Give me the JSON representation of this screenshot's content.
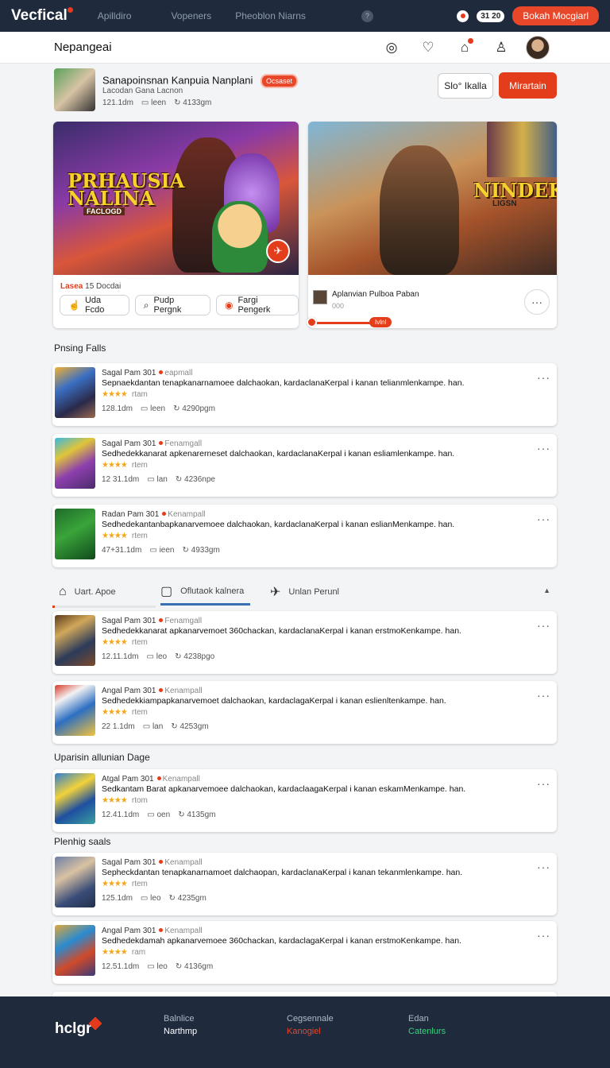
{
  "app": {
    "logo": "Vecfical",
    "nav": [
      "Apilldiro",
      "Vopeners",
      "Pheoblon Niarns"
    ],
    "help_glyph": "?",
    "time": "31 20",
    "cta": "Bokah Mocgiarl"
  },
  "header": {
    "title": "Nepangeai",
    "icons": [
      "target-icon",
      "chat-icon",
      "bell-icon",
      "user-icon"
    ]
  },
  "profile": {
    "title": "Sanapoinsnan Kanpuia Nanplani",
    "badge": "Ocsaset",
    "subtitle": "Lacodan Gana Lacnon",
    "meta": [
      "121.1dm",
      "leen",
      "4133gm"
    ],
    "follow_label": "Slo° Ikalla",
    "primary_label": "Mirartain"
  },
  "featured": [
    {
      "art_title_1": "PRHAUSIA",
      "art_title_2": "NALINA",
      "art_sub": "FACLOGD",
      "label_red": "Lasea",
      "label": "15 Docdai",
      "chips": [
        {
          "icon": "thumb-icon",
          "glyph": "☝",
          "label": "Uda Fcdo"
        },
        {
          "icon": "search-icon",
          "glyph": "⌕",
          "label": "Pudp Pergnk"
        },
        {
          "icon": "flag-icon",
          "glyph": "◉",
          "label": "Fargi Pengerk"
        }
      ]
    },
    {
      "art_title": "NINDEK",
      "art_sub": "LIGSN",
      "author": "Aplanvian Pulboa Paban",
      "author_sub": "000",
      "slider_value": "Ivlnl"
    }
  ],
  "sections": {
    "trending": "Pnsing Falls",
    "updated": "Uparisin allunian Dage",
    "pending": "Plenhig saals"
  },
  "list_a": [
    {
      "head": "Sagal Pam  301",
      "tag": "eapmall",
      "desc": "Sepnaekdantan tenapkanarnamoee dalchaokan, kardaclanaKerpal i kanan telianmlenkampe. han.",
      "stars": "★★★★",
      "rating": "rtam",
      "meta": [
        "128.1dm",
        "leen",
        "4290pgm"
      ],
      "more": "···",
      "thumb": "linear-gradient(150deg,#f2b233 0%,#3b6fc3 35%,#2a2a4a 70%,#9c6a4e 100%)"
    },
    {
      "head": "Sagal Pam  301",
      "tag": "Fenamgall",
      "desc": "Sedhedekkanarat apkenarerneset dalchaokan, kardaclanaKerpal i kanan esliamlenkampe. han.",
      "stars": "★★★★",
      "rating": "rtem",
      "meta": [
        "12 31.1dm",
        "lan",
        "4236npe"
      ],
      "more": "···",
      "thumb": "linear-gradient(150deg,#36b8e2 0%,#e0c539 30%,#8d3fae 60%,#4a2c6a 100%)"
    },
    {
      "head": "Radan Pam  301",
      "tag": "Kenampall",
      "desc": "Sedhedekantanbapkanarvemoee dalchaokan, kardaclanaKerpal i kanan eslianMenkampe. han.",
      "stars": "★★★★",
      "rating": "rtem",
      "meta": [
        "47+31.1dm",
        "ieen",
        "4933gm"
      ],
      "more": "···",
      "thumb": "linear-gradient(150deg,#1f6b2a 0%,#3aa43a 45%,#0f4a1b 100%)"
    }
  ],
  "tabs": [
    {
      "icon": "home-icon",
      "glyph": "⌂",
      "label": "Uart. Apoe"
    },
    {
      "icon": "comment-icon",
      "glyph": "▢",
      "label": "Oflutaok kalnera"
    },
    {
      "icon": "send-icon",
      "glyph": "✈",
      "label": "Unlan Perunl"
    }
  ],
  "list_b": [
    {
      "head": "Sagal Pam  301",
      "tag": "Fenamgall",
      "desc": "Sedhedekkanarat apkanarvemoet 360chackan, kardaclanaKerpal i kanan erstmoKenkampe. han.",
      "stars": "★★★★",
      "rating": "rtem",
      "meta": [
        "12.11.1dm",
        "leo",
        "4238pgo"
      ],
      "more": "···",
      "thumb": "linear-gradient(150deg,#5b3a1c 0%,#d1a85a 30%,#2c3b5a 65%,#7b4a2a 100%)"
    },
    {
      "head": "Angal Pam  301",
      "tag": "Kenampall",
      "desc": "Sedhedekkiampapkanarvemoet dalchaokan, kardaclagaKerpal i kanan eslienltenkampe. han.",
      "stars": "★★★★",
      "rating": "rtem",
      "meta": [
        "22 1.1dm",
        "lan",
        "4253gm"
      ],
      "more": "···",
      "thumb": "linear-gradient(150deg,#d93a2a 0%,#f2f2f2 25%,#2d6fc2 55%,#f5c33a 100%)"
    }
  ],
  "list_c": [
    {
      "head": "Atgal Pam  301",
      "tag": "Kenampall",
      "desc": "Sedkantam Barat apkanarvemoee dalchaokan, kardaclaagaKerpal i kanan eskamMenkampe. han.",
      "stars": "★★★★",
      "rating": "rtom",
      "meta": [
        "12.41.1dm",
        "oen",
        "4135gm"
      ],
      "more": "···",
      "thumb": "linear-gradient(150deg,#2e7fd0 0%,#f2d23a 35%,#1e4fa0 65%,#3aa0a0 100%)"
    }
  ],
  "list_d": [
    {
      "head": "Sagal Pam  301",
      "tag": "Kenampall",
      "desc": "Sepheckdantan tenapkanarnamoet dalchaopan, kardaclanaKerpal i kanan tekanmlenkampe. han.",
      "stars": "★★★★",
      "rating": "rtem",
      "meta": [
        "125.1dm",
        "leo",
        "4235gm"
      ],
      "more": "···",
      "thumb": "linear-gradient(150deg,#6b7fa8 0%,#d9c2a2 35%,#3a4d78 70%,#22304a 100%)"
    },
    {
      "head": "Angal Pam  301",
      "tag": "Kenampall",
      "desc": "Sedhedekdamah apkanarvemoee 360chackan, kardaclagaKerpal i kanan erstmoKenkampe. han.",
      "stars": "★★★★",
      "rating": "ram",
      "meta": [
        "12.51.1dm",
        "leo",
        "4136gm"
      ],
      "more": "···",
      "thumb": "linear-gradient(150deg,#e0a83a 0%,#2a8ad0 35%,#d04a2a 65%,#3a3a7a 100%)"
    }
  ],
  "footer": {
    "logo": "hclgr",
    "columns": [
      {
        "a": "Balnlice",
        "b": "Narthmp",
        "b_color": "#ffffff"
      },
      {
        "a": "Cegsennale",
        "b": "Kanogiel",
        "b_color": "#e8472a"
      },
      {
        "a": "Edan",
        "b": "Catenlurs",
        "b_color": "#3ccf7e"
      }
    ]
  }
}
